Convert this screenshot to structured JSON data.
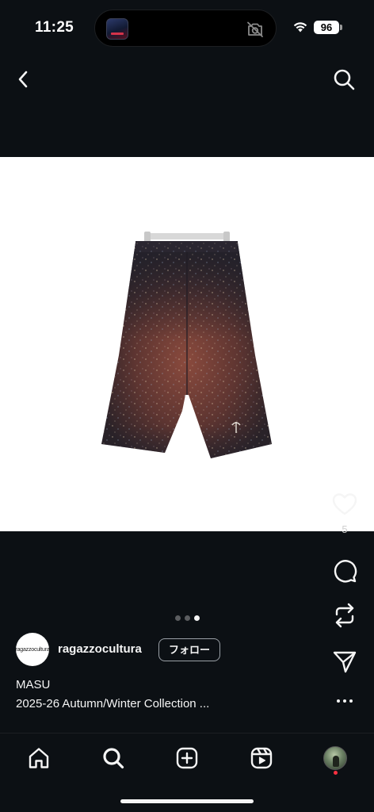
{
  "status_bar": {
    "time": "11:25",
    "battery": "96"
  },
  "nav": {
    "back_icon": "chevron-left-icon",
    "search_icon": "search-icon"
  },
  "post": {
    "carousel": {
      "count": 3,
      "active_index": 2
    },
    "actions": {
      "like_icon": "heart-icon",
      "like_count": "5",
      "comment_icon": "comment-icon",
      "repost_icon": "repost-icon",
      "share_icon": "send-icon"
    },
    "author": {
      "avatar_text": "ragazzocultura",
      "username": "ragazzocultura",
      "follow_label": "フォロー"
    },
    "caption": {
      "title": "MASU",
      "text": "2025-26 Autumn/Winter Collection ..."
    },
    "more_icon": "more-horizontal-icon"
  },
  "tab_bar": {
    "items": [
      "home-icon",
      "search-icon",
      "create-icon",
      "reels-icon",
      "profile-avatar"
    ]
  },
  "colors": {
    "background": "#0c1014",
    "text": "#f5f5f5",
    "notification": "#ff3040"
  }
}
